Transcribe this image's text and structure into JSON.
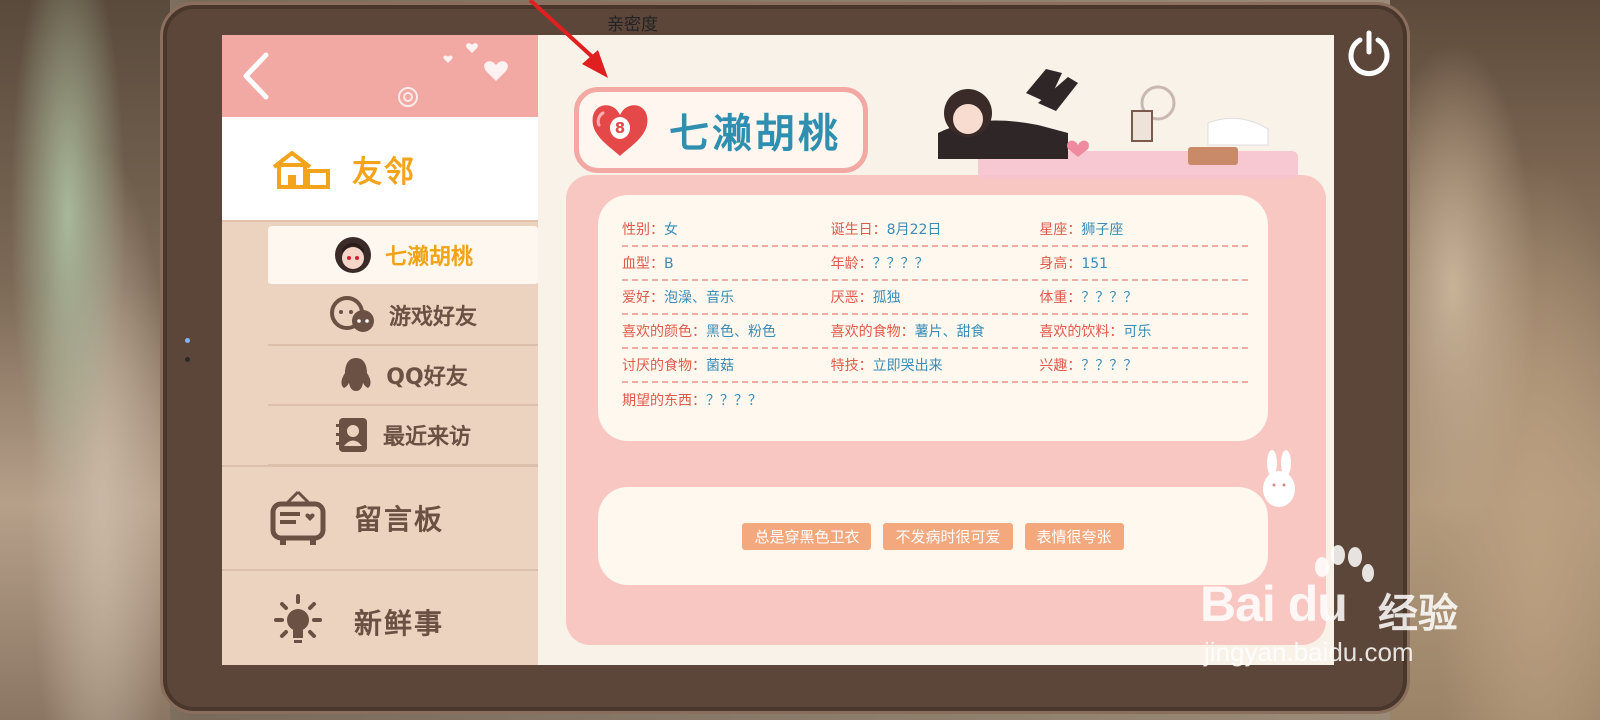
{
  "annotation": {
    "label": "亲密度"
  },
  "sidebar": {
    "main_nav": "友邻",
    "sub_items": [
      {
        "label": "七濑胡桃",
        "icon": "character-avatar-icon"
      },
      {
        "label": "游戏好友",
        "icon": "chat-faces-icon"
      },
      {
        "label": "QQ好友",
        "icon": "penguin-icon"
      },
      {
        "label": "最近来访",
        "icon": "contact-book-icon"
      }
    ],
    "big_items": [
      {
        "label": "留言板",
        "icon": "message-board-icon"
      },
      {
        "label": "新鲜事",
        "icon": "lightbulb-icon"
      }
    ]
  },
  "profile": {
    "intimacy_level": "8",
    "name": "七濑胡桃",
    "rows": [
      [
        {
          "k": "性别：",
          "v": "女"
        },
        {
          "k": "诞生日：",
          "v": "8月22日"
        },
        {
          "k": "星座：",
          "v": "狮子座"
        }
      ],
      [
        {
          "k": "血型：",
          "v": "B"
        },
        {
          "k": "年龄：",
          "v": "？？？？"
        },
        {
          "k": "身高：",
          "v": "151"
        }
      ],
      [
        {
          "k": "爱好：",
          "v": "泡澡、音乐"
        },
        {
          "k": "厌恶：",
          "v": "孤独"
        },
        {
          "k": "体重：",
          "v": "？？？？"
        }
      ],
      [
        {
          "k": "喜欢的颜色：",
          "v": "黑色、粉色"
        },
        {
          "k": "喜欢的食物：",
          "v": "薯片、甜食"
        },
        {
          "k": "喜欢的饮料：",
          "v": "可乐"
        }
      ],
      [
        {
          "k": "讨厌的食物：",
          "v": "菌菇"
        },
        {
          "k": "特技：",
          "v": "立即哭出来"
        },
        {
          "k": "兴趣：",
          "v": "？？？？"
        }
      ],
      [
        {
          "k": "期望的东西：",
          "v": "？？？？"
        }
      ]
    ],
    "tags": [
      "总是穿黑色卫衣",
      "不发病时很可爱",
      "表情很夸张"
    ]
  },
  "watermark": {
    "logo": "Bai du",
    "cn": "经验",
    "url": "jingyan.baidu.com"
  },
  "colors": {
    "accent": "#f3a41c",
    "name": "#2f8fb0",
    "panel": "#f9c7c2",
    "tag": "#f3a87e"
  }
}
